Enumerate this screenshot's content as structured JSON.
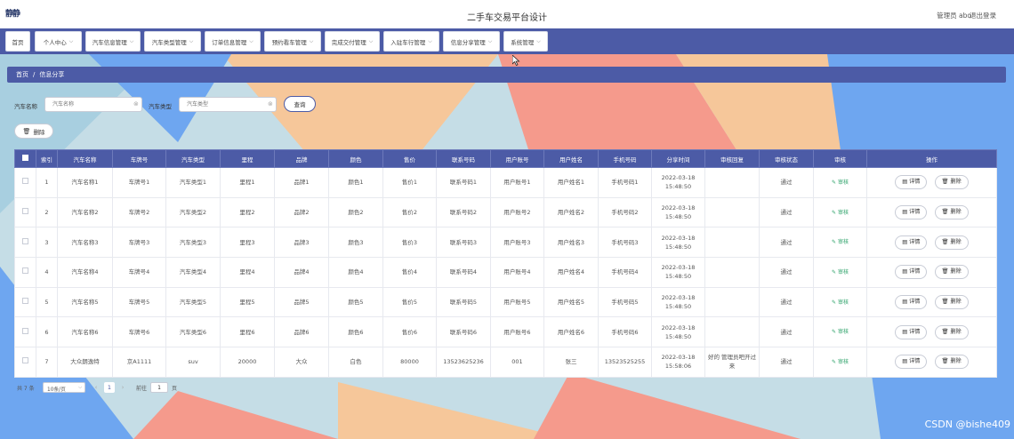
{
  "header": {
    "logo_text": "静静",
    "site_title": "二手车交易平台设计",
    "user_info": "管理员 abo",
    "logout": "退出登录"
  },
  "nav": {
    "items": [
      {
        "label": "首页",
        "has_dropdown": false
      },
      {
        "label": "个人中心",
        "has_dropdown": true
      },
      {
        "label": "汽车信息管理",
        "has_dropdown": true
      },
      {
        "label": "汽车类型管理",
        "has_dropdown": true
      },
      {
        "label": "订单信息管理",
        "has_dropdown": true
      },
      {
        "label": "预约看车管理",
        "has_dropdown": true
      },
      {
        "label": "完成交付管理",
        "has_dropdown": true
      },
      {
        "label": "入驻车行管理",
        "has_dropdown": true
      },
      {
        "label": "信息分享管理",
        "has_dropdown": true
      },
      {
        "label": "系统管理",
        "has_dropdown": true
      }
    ]
  },
  "breadcrumb": {
    "home": "首页",
    "separator": "/",
    "current": "信息分享"
  },
  "search": {
    "car_name_label": "汽车名称",
    "car_name_placeholder": "汽车名称",
    "car_name_value": "",
    "car_type_label": "汽车类型",
    "car_type_placeholder": "汽车类型",
    "car_type_value": "",
    "query_button": "查询"
  },
  "toolbar": {
    "delete_button": "删除"
  },
  "table": {
    "columns": [
      "索引",
      "汽车名称",
      "车牌号",
      "汽车类型",
      "里程",
      "品牌",
      "颜色",
      "售价",
      "联系号码",
      "用户账号",
      "用户姓名",
      "手机号码",
      "分享时间",
      "审核回复",
      "审核状态",
      "审核",
      "操作"
    ],
    "audit_link": "审核",
    "detail_button": "详情",
    "delete_button": "删除",
    "rows": [
      {
        "index": "1",
        "car_name": "汽车名称1",
        "plate": "车牌号1",
        "car_type": "汽车类型1",
        "mileage": "里程1",
        "brand": "品牌1",
        "color": "颜色1",
        "price": "售价1",
        "contact": "联系号码1",
        "account": "用户账号1",
        "user_name": "用户姓名1",
        "phone": "手机号码1",
        "share_time": "2022-03-18 15:48:50",
        "reply": "",
        "status": "通过"
      },
      {
        "index": "2",
        "car_name": "汽车名称2",
        "plate": "车牌号2",
        "car_type": "汽车类型2",
        "mileage": "里程2",
        "brand": "品牌2",
        "color": "颜色2",
        "price": "售价2",
        "contact": "联系号码2",
        "account": "用户账号2",
        "user_name": "用户姓名2",
        "phone": "手机号码2",
        "share_time": "2022-03-18 15:48:50",
        "reply": "",
        "status": "通过"
      },
      {
        "index": "3",
        "car_name": "汽车名称3",
        "plate": "车牌号3",
        "car_type": "汽车类型3",
        "mileage": "里程3",
        "brand": "品牌3",
        "color": "颜色3",
        "price": "售价3",
        "contact": "联系号码3",
        "account": "用户账号3",
        "user_name": "用户姓名3",
        "phone": "手机号码3",
        "share_time": "2022-03-18 15:48:50",
        "reply": "",
        "status": "通过"
      },
      {
        "index": "4",
        "car_name": "汽车名称4",
        "plate": "车牌号4",
        "car_type": "汽车类型4",
        "mileage": "里程4",
        "brand": "品牌4",
        "color": "颜色4",
        "price": "售价4",
        "contact": "联系号码4",
        "account": "用户账号4",
        "user_name": "用户姓名4",
        "phone": "手机号码4",
        "share_time": "2022-03-18 15:48:50",
        "reply": "",
        "status": "通过"
      },
      {
        "index": "5",
        "car_name": "汽车名称5",
        "plate": "车牌号5",
        "car_type": "汽车类型5",
        "mileage": "里程5",
        "brand": "品牌5",
        "color": "颜色5",
        "price": "售价5",
        "contact": "联系号码5",
        "account": "用户账号5",
        "user_name": "用户姓名5",
        "phone": "手机号码5",
        "share_time": "2022-03-18 15:48:50",
        "reply": "",
        "status": "通过"
      },
      {
        "index": "6",
        "car_name": "汽车名称6",
        "plate": "车牌号6",
        "car_type": "汽车类型6",
        "mileage": "里程6",
        "brand": "品牌6",
        "color": "颜色6",
        "price": "售价6",
        "contact": "联系号码6",
        "account": "用户账号6",
        "user_name": "用户姓名6",
        "phone": "手机号码6",
        "share_time": "2022-03-18 15:48:50",
        "reply": "",
        "status": "通过"
      },
      {
        "index": "7",
        "car_name": "大众朗逸特",
        "plate": "京A1111",
        "car_type": "suv",
        "mileage": "20000",
        "brand": "大众",
        "color": "白色",
        "price": "80000",
        "contact": "13523625236",
        "account": "001",
        "user_name": "张三",
        "phone": "13523525255",
        "share_time": "2022-03-18 15:58:06",
        "reply": "好的 管理员吧开过来",
        "status": "通过"
      }
    ]
  },
  "pagination": {
    "total": "共 7 条",
    "page_size": "10条/页",
    "current_page": "1",
    "goto_label": "前往",
    "goto_value": "1",
    "page_suffix": "页"
  },
  "watermark": "CSDN @bishe409",
  "colors": {
    "primary": "#4c5ba6",
    "audit_green": "#2fa36b"
  }
}
